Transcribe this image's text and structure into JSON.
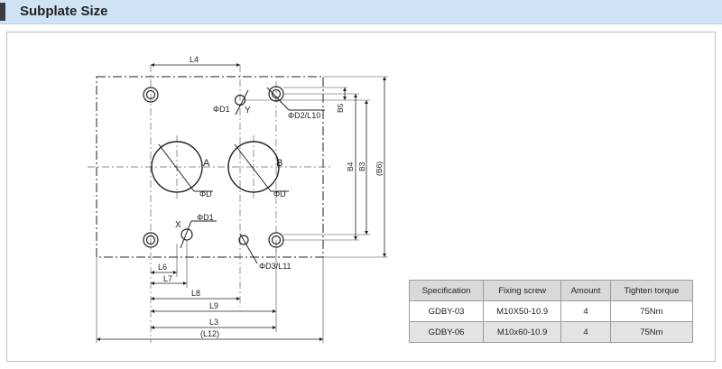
{
  "header": {
    "title": "Subplate Size"
  },
  "diagram": {
    "labels": {
      "L4": "L4",
      "L6": "L6",
      "L7": "L7",
      "L8": "L8",
      "L9": "L9",
      "L3": "L3",
      "L12": "(L12)",
      "B5": "B5",
      "B4": "B4",
      "B3": "B3",
      "B6": "(B6)",
      "D1_top": "ΦD1",
      "Y": "Y",
      "D2_L10": "ΦD2/L10",
      "A": "A",
      "B": "B",
      "D_left": "ΦD",
      "D_right": "ΦD",
      "X": "X",
      "D1_bottom": "ΦD1",
      "D3_L11": "ΦD3/L11"
    }
  },
  "table": {
    "headers": [
      "Specification",
      "Fixing screw",
      "Amount",
      "Tighten torque"
    ],
    "rows": [
      [
        "GDBY-03",
        "M10X50-10.9",
        "4",
        "75Nm"
      ],
      [
        "GDBY-06",
        "M10x60-10.9",
        "4",
        "75Nm"
      ]
    ]
  }
}
